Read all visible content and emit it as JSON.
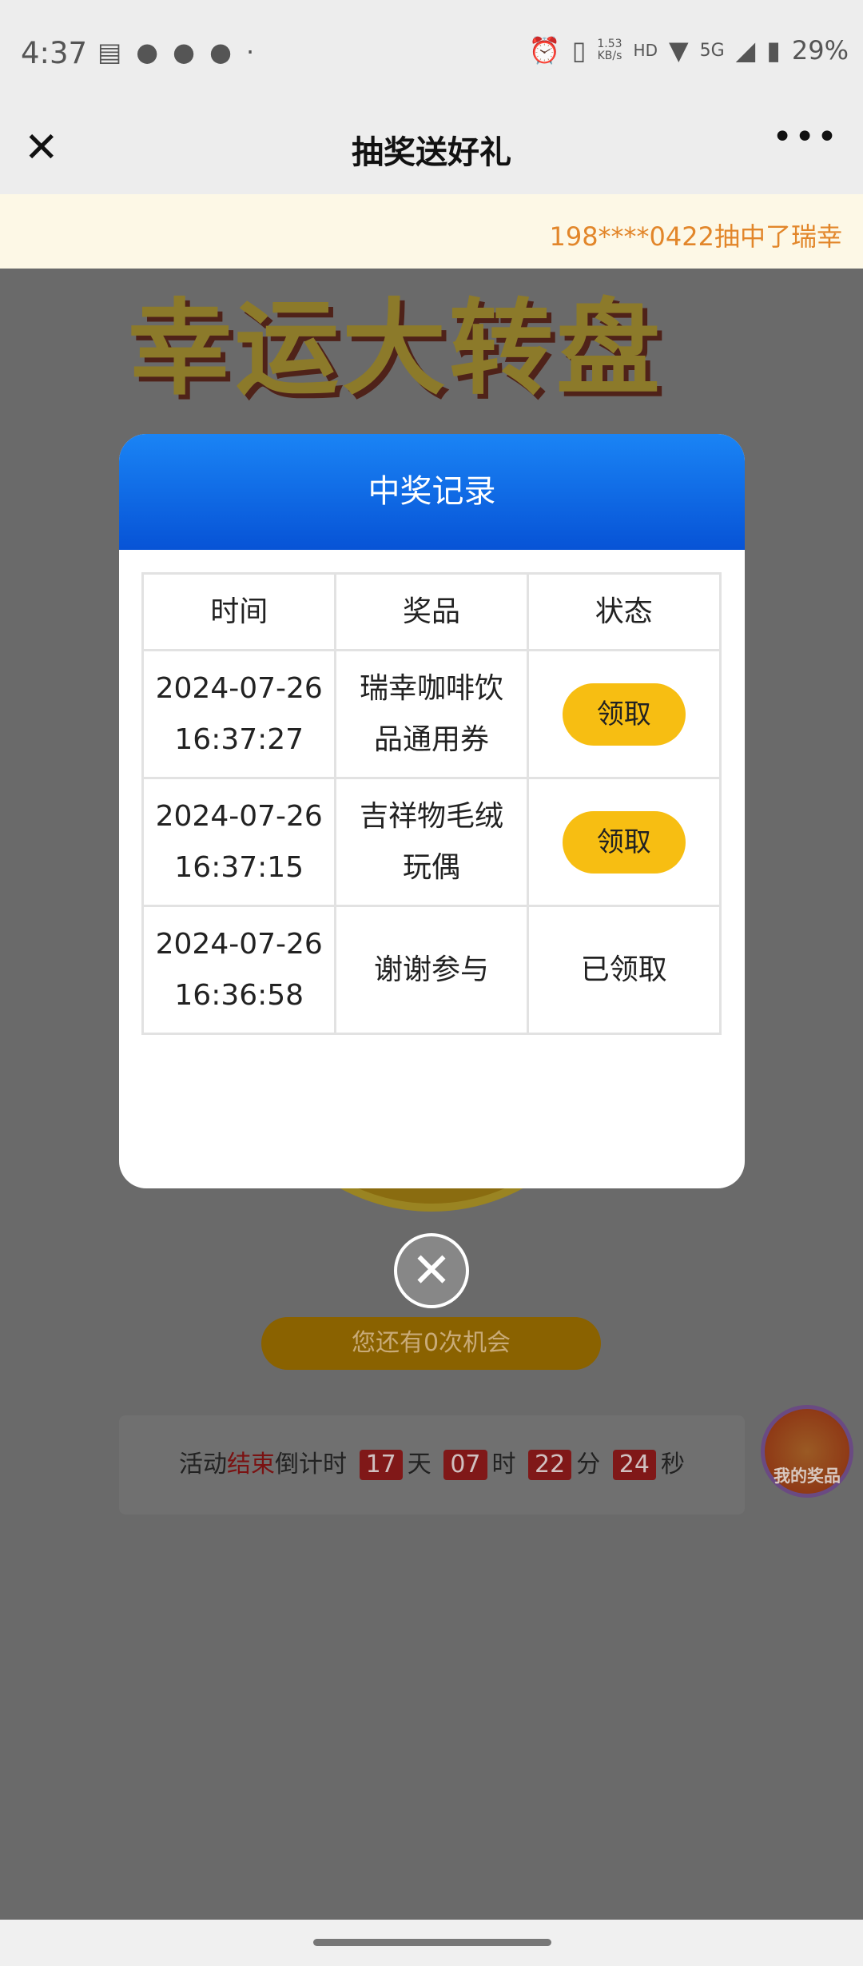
{
  "status_bar": {
    "time": "4:37",
    "speed": "1.53",
    "speed_unit": "KB/s",
    "network": "5G",
    "battery": "29%"
  },
  "nav": {
    "close_icon": "close-icon",
    "title": "抽奖送好礼",
    "more_icon": "more-icon"
  },
  "banner": {
    "text": "198****0422抽中了瑞幸"
  },
  "background": {
    "title": "幸运大转盘",
    "chance_button": "您还有0次机会",
    "countdown": {
      "prefix": "活动",
      "highlight": "结束",
      "label": "倒计时",
      "days": "17",
      "day_unit": "天",
      "hours": "07",
      "hour_unit": "时",
      "minutes": "22",
      "minute_unit": "分",
      "seconds": "24",
      "second_unit": "秒"
    },
    "my_prizes": "我的奖品"
  },
  "modal": {
    "title": "中奖记录",
    "headers": [
      "时间",
      "奖品",
      "状态"
    ],
    "rows": [
      {
        "date": "2024-07-26",
        "time": "16:37:27",
        "prize": "瑞幸咖啡饮品通用券",
        "status": "领取",
        "claimable": true
      },
      {
        "date": "2024-07-26",
        "time": "16:37:15",
        "prize": "吉祥物毛绒玩偶",
        "status": "领取",
        "claimable": true
      },
      {
        "date": "2024-07-26",
        "time": "16:36:58",
        "prize": "谢谢参与",
        "status": "已领取",
        "claimable": false
      }
    ]
  },
  "colors": {
    "header_blue": "#1a84f5",
    "claim_yellow": "#f7be12",
    "banner_text": "#e2862a",
    "countdown_red": "#dd2222"
  }
}
